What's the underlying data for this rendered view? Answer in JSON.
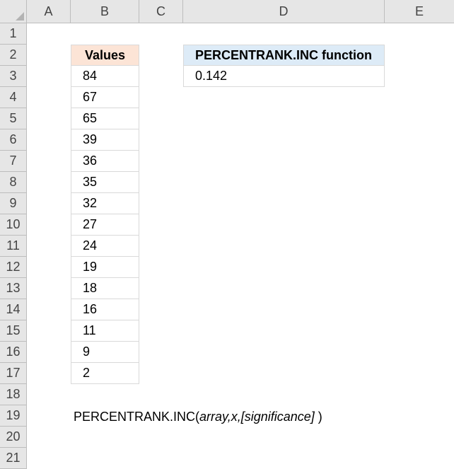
{
  "columns": [
    "A",
    "B",
    "C",
    "D",
    "E"
  ],
  "rows": [
    "1",
    "2",
    "3",
    "4",
    "5",
    "6",
    "7",
    "8",
    "9",
    "10",
    "11",
    "12",
    "13",
    "14",
    "15",
    "16",
    "17",
    "18",
    "19",
    "20",
    "21"
  ],
  "values_table": {
    "header": "Values",
    "items": [
      "84",
      "67",
      "65",
      "39",
      "36",
      "35",
      "32",
      "27",
      "24",
      "19",
      "18",
      "16",
      "11",
      "9",
      "2"
    ]
  },
  "result_table": {
    "header": "PERCENTRANK.INC function",
    "value": "0.142"
  },
  "syntax": {
    "fn": "PERCENTRANK.INC(",
    "args": "array,x,[significance]",
    "close": " )"
  },
  "colors": {
    "header_bg": "#e6e6e6",
    "values_header_bg": "#fce4d6",
    "result_header_bg": "#ddebf7",
    "gridline": "#d9d9d9"
  }
}
